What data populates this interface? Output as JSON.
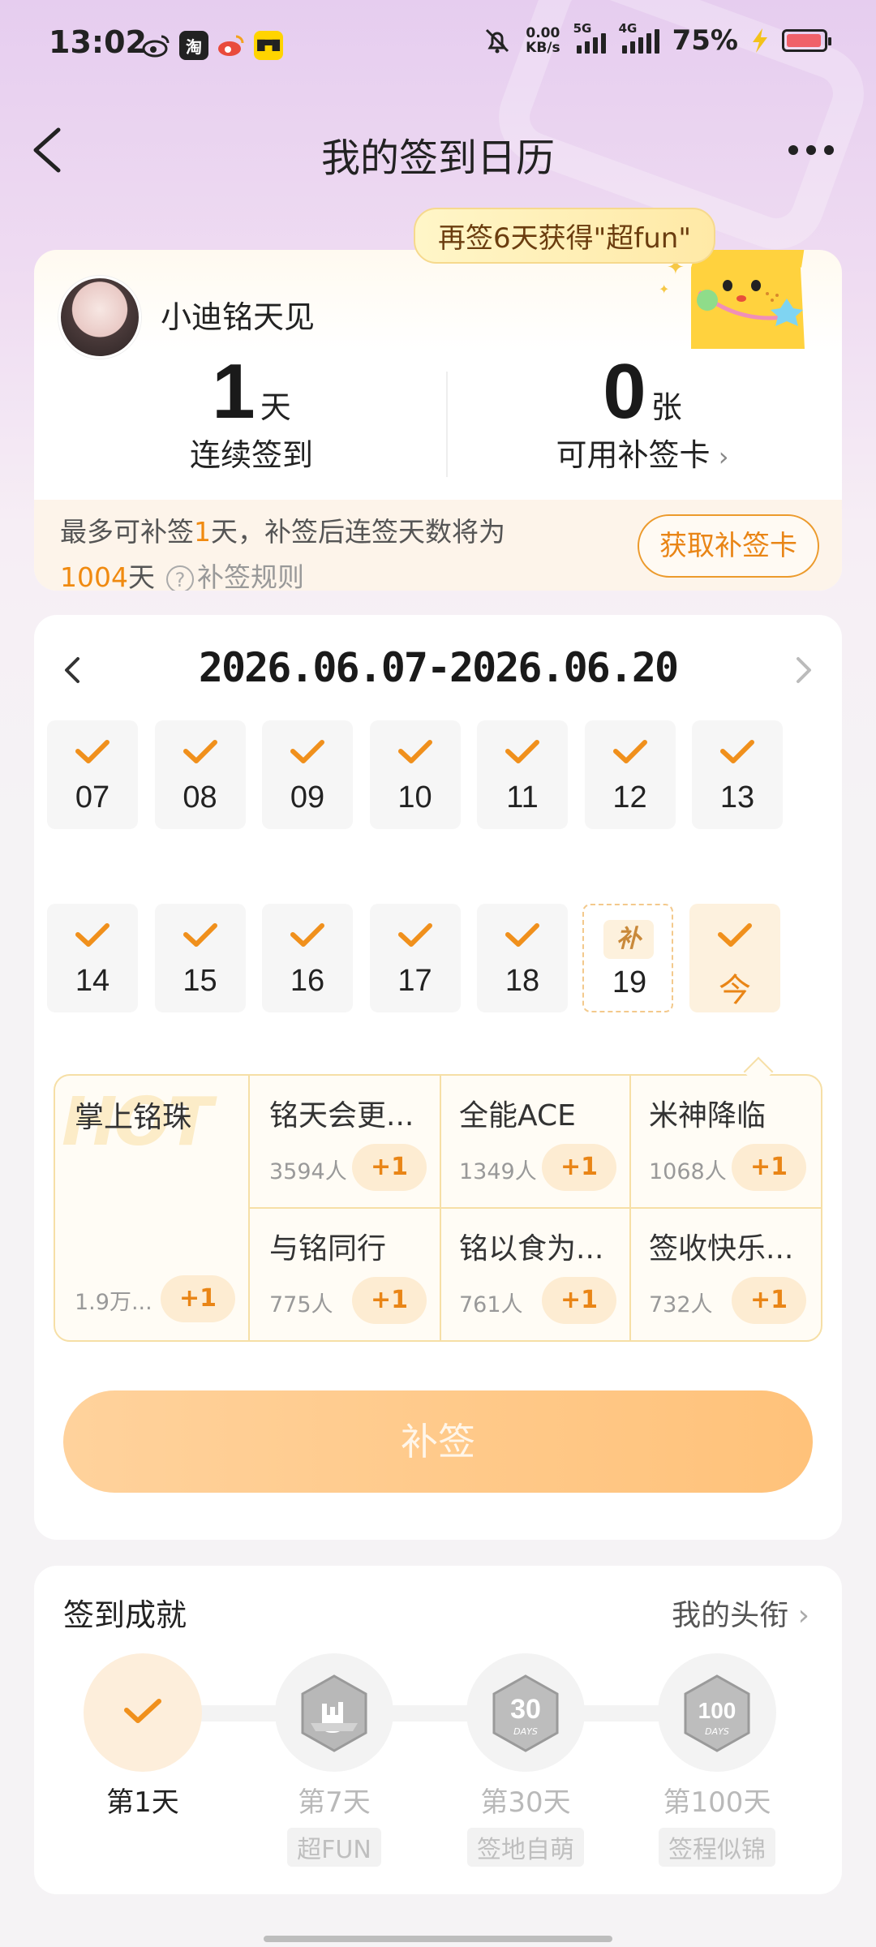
{
  "status_bar": {
    "time": "13:02",
    "net_speed": "0.00",
    "net_unit": "KB/s",
    "sig1": "5G",
    "sig2": "4G",
    "battery": "75%",
    "apps": [
      "weibo",
      "taobao",
      "weibo-red",
      "yellow-app"
    ]
  },
  "nav": {
    "title": "我的签到日历"
  },
  "profile": {
    "bubble": "再签6天获得\"超fun\"",
    "username": "小迪铭天见",
    "streak_num": "1",
    "streak_unit": "天",
    "streak_label": "连续签到",
    "cards_num": "0",
    "cards_unit": "张",
    "cards_label": "可用补签卡",
    "foot_line1_a": "最多可补签",
    "foot_line1_hl": "1",
    "foot_line1_b": "天，补签后连签天数将为",
    "foot_line2_hl": "1004",
    "foot_line2_b": "天",
    "rule_label": "补签规则",
    "get_card": "获取补签卡"
  },
  "calendar": {
    "range": "2026.06.07-2026.06.20",
    "week1": [
      "07",
      "08",
      "09",
      "10",
      "11",
      "12",
      "13"
    ],
    "week2": [
      "14",
      "15",
      "16",
      "17",
      "18"
    ],
    "missed_tag": "补",
    "missed_day": "19",
    "today": "今"
  },
  "groups": {
    "featured": {
      "name": "掌上铭珠",
      "hot": "HOT",
      "count": "1.9万...",
      "plus": "+1"
    },
    "items": [
      {
        "name": "铭天会更...",
        "count": "3594人",
        "plus": "+1"
      },
      {
        "name": "全能ACE",
        "count": "1349人",
        "plus": "+1"
      },
      {
        "name": "米神降临",
        "count": "1068人",
        "plus": "+1"
      },
      {
        "name": "与铭同行",
        "count": "775人",
        "plus": "+1"
      },
      {
        "name": "铭以食为...",
        "count": "761人",
        "plus": "+1"
      },
      {
        "name": "签收快乐...",
        "count": "732人",
        "plus": "+1"
      }
    ]
  },
  "resign_button": "补签",
  "achievements": {
    "title": "签到成就",
    "link": "我的头衔",
    "items": [
      {
        "name": "第1天",
        "tag": ""
      },
      {
        "name": "第7天",
        "tag": "超FUN"
      },
      {
        "name": "第30天",
        "tag": "签地自萌"
      },
      {
        "name": "第100天",
        "tag": "签程似锦"
      }
    ],
    "badge_30": "30",
    "badge_100": "100",
    "badge_days": "DAYS"
  },
  "colors": {
    "accent": "#e98516",
    "check": "#f0901c",
    "button": "#ffc27a"
  }
}
